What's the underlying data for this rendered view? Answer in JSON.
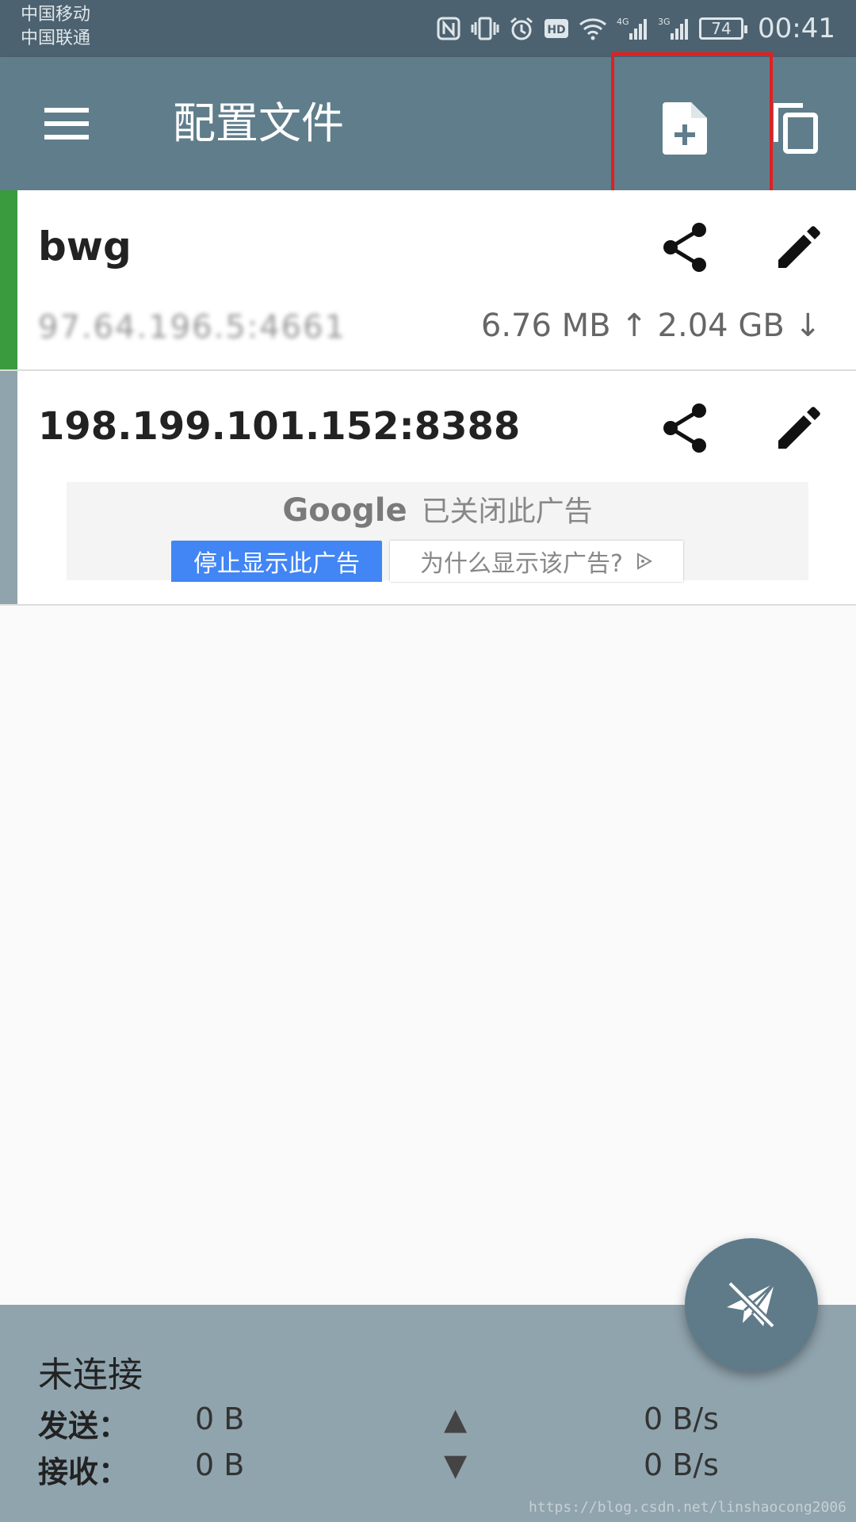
{
  "status_bar": {
    "carrier_1": "中国移动",
    "carrier_2": "中国联通",
    "net_4g": "4G",
    "net_3g": "3G",
    "battery": "74",
    "time": "00:41",
    "icons": [
      "nfc-icon",
      "vibrate-icon",
      "alarm-icon",
      "hd-icon",
      "wifi-icon",
      "signal-4g-icon",
      "signal-3g-icon",
      "battery-icon"
    ]
  },
  "app_bar": {
    "title": "配置文件",
    "icons": [
      "menu-icon",
      "add-file-icon",
      "copy-icon"
    ]
  },
  "profiles": [
    {
      "name": "bwg",
      "host": "97.64.196.5:4661",
      "traffic": "6.76 MB ↑ 2.04 GB ↓",
      "accent": "#3a9a3e",
      "active": true
    },
    {
      "name": "198.199.101.152:8388",
      "accent": "#90a4ae",
      "active": false
    }
  ],
  "ad": {
    "brand": "Google",
    "closed_text": "已关闭此广告",
    "stop_label": "停止显示此广告",
    "why_label": "为什么显示该广告?"
  },
  "stats": {
    "status": "未连接",
    "send_label": "发送：",
    "send_total": "0 B",
    "send_arrow": "▲",
    "send_rate": "0 B/s",
    "recv_label": "接收：",
    "recv_total": "0 B",
    "recv_arrow": "▼",
    "recv_rate": "0 B/s"
  },
  "watermark": "https://blog.csdn.net/linshaocong2006",
  "colors": {
    "app_bar": "#607d8b",
    "status_bar": "#4d6270",
    "bottom_panel": "#90a4ae",
    "highlight": "#e02020"
  }
}
